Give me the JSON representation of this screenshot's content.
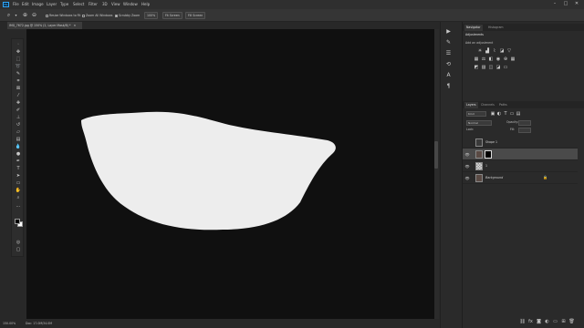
{
  "app": {
    "logo": "Ps"
  },
  "menu": [
    "File",
    "Edit",
    "Image",
    "Layer",
    "Type",
    "Select",
    "Filter",
    "3D",
    "View",
    "Window",
    "Help"
  ],
  "window_controls": {
    "minimize": "–",
    "maximize": "□",
    "close": "✕"
  },
  "options_bar": {
    "resize_windows": "Resize Windows to Fit",
    "zoom_all_windows": "Zoom All Windows",
    "scrubby_zoom": "Scrubby Zoom",
    "zoom_100": "100%",
    "fit_screen": "Fit Screen",
    "fill_screen": "Fill Screen"
  },
  "document": {
    "tab_label": "IMG_7672.jpg @ 150% (2, Layer Mask/8) *",
    "close": "✕"
  },
  "status_bar": {
    "zoom": "150.00%",
    "doc_info": "Doc: 17.0M/34.0M"
  },
  "panels": {
    "top_tabs": [
      "Navigator",
      "Histogram"
    ],
    "adjustments_title": "Adjustments",
    "adjustments_subtitle": "Add an adjustment",
    "layers_tabs": [
      "Layers",
      "Channels",
      "Paths"
    ],
    "kind_label": "Kind",
    "normal_label": "Normal",
    "opacity_label": "Opacity:",
    "fill_label": "Fill:",
    "lock_label": "Lock:",
    "layers": [
      {
        "name": "Shape 1",
        "selected": false
      },
      {
        "name": "",
        "selected": true
      },
      {
        "name": "1",
        "selected": false
      },
      {
        "name": "Background",
        "selected": false
      }
    ]
  },
  "colors": {
    "accent": "#31a8ff",
    "document_bg": "#101010",
    "shape_fill": "#ededed",
    "ui_bg": "#282828"
  }
}
